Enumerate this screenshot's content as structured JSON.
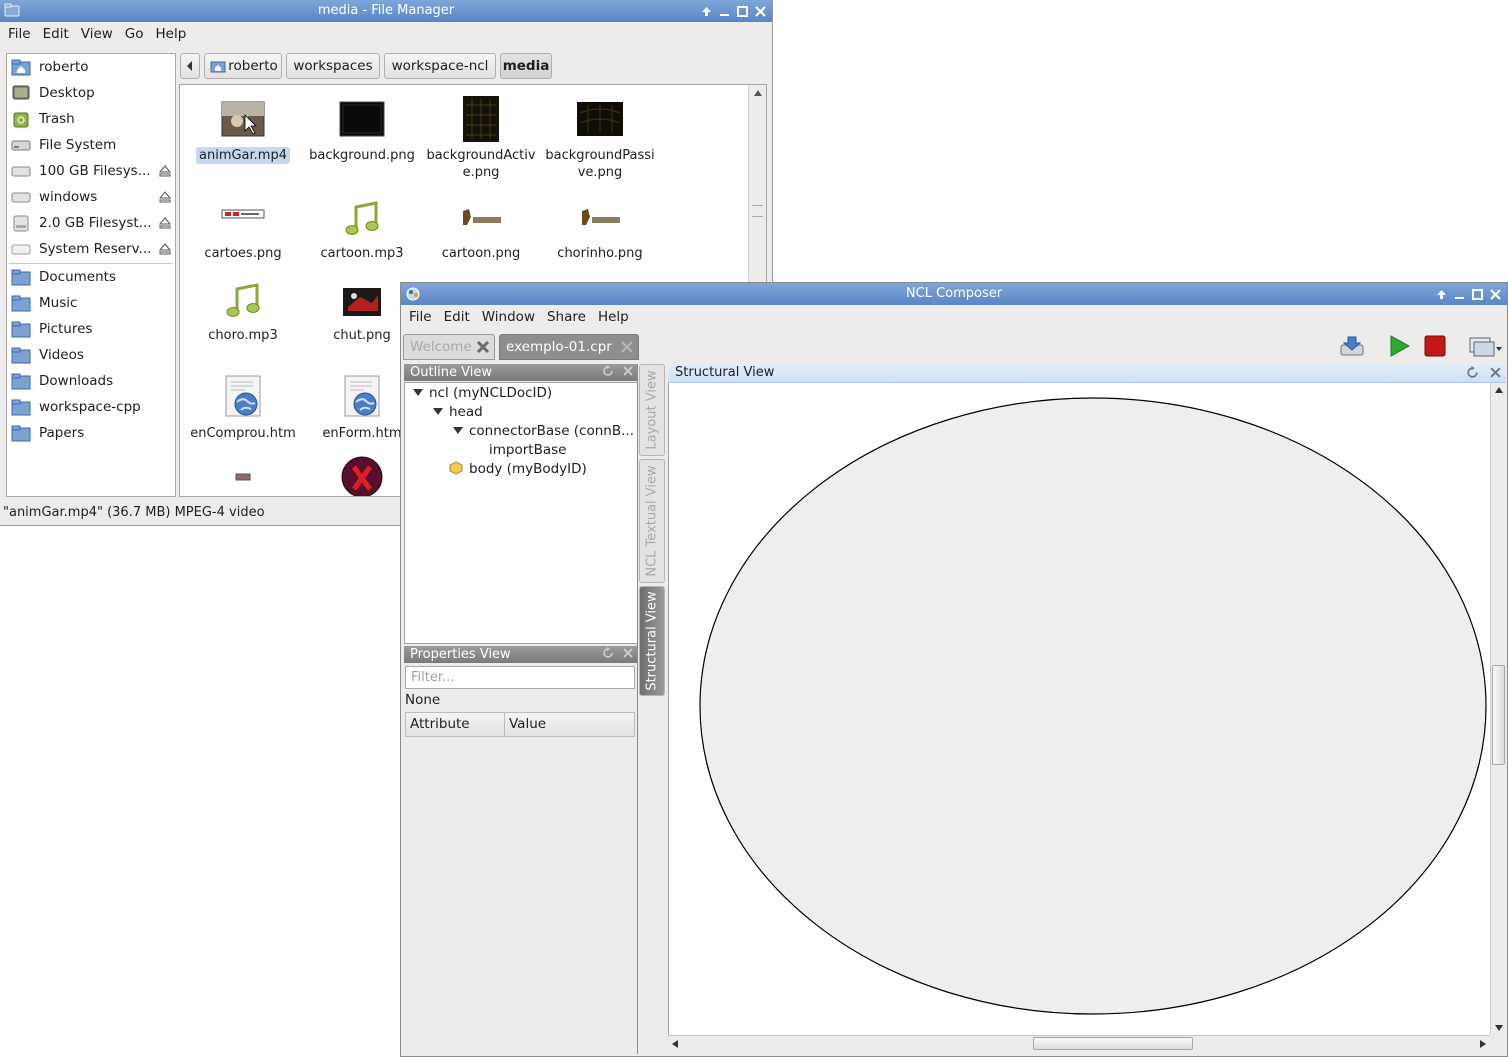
{
  "file_manager": {
    "title": "media - File Manager",
    "menu": [
      "File",
      "Edit",
      "View",
      "Go",
      "Help"
    ],
    "sidebar": [
      {
        "label": "roberto",
        "icon": "home-folder-icon"
      },
      {
        "label": "Desktop",
        "icon": "desktop-icon"
      },
      {
        "label": "Trash",
        "icon": "trash-icon"
      },
      {
        "label": "File System",
        "icon": "drive-icon"
      },
      {
        "label": "100 GB Filesys...",
        "icon": "drive-icon",
        "eject": true
      },
      {
        "label": "windows",
        "icon": "drive-icon",
        "eject": true
      },
      {
        "label": "2.0 GB Filesyst...",
        "icon": "drive-icon",
        "eject": true
      },
      {
        "label": "System Reserv...",
        "icon": "drive-icon",
        "eject": true
      },
      {
        "label": "Documents",
        "icon": "folder-icon"
      },
      {
        "label": "Music",
        "icon": "folder-icon"
      },
      {
        "label": "Pictures",
        "icon": "folder-icon"
      },
      {
        "label": "Videos",
        "icon": "folder-icon"
      },
      {
        "label": "Downloads",
        "icon": "folder-icon"
      },
      {
        "label": "workspace-cpp",
        "icon": "folder-icon"
      },
      {
        "label": "Papers",
        "icon": "folder-icon"
      }
    ],
    "path": [
      "roberto",
      "workspaces",
      "workspace-ncl",
      "media"
    ],
    "files": [
      {
        "name": "animGar.mp4",
        "selected": true
      },
      {
        "name": "background.png"
      },
      {
        "name": "backgroundActiv\ne.png"
      },
      {
        "name": "backgroundPassi\nve.png"
      },
      {
        "name": "cartoes.png"
      },
      {
        "name": "cartoon.mp3"
      },
      {
        "name": "cartoon.png"
      },
      {
        "name": "chorinho.png"
      },
      {
        "name": "choro.mp3"
      },
      {
        "name": "chut.png"
      },
      {
        "name": "enComprou.htm"
      },
      {
        "name": "enForm.htm"
      }
    ],
    "status": "\"animGar.mp4\" (36.7 MB) MPEG-4 video"
  },
  "ncl_composer": {
    "title": "NCL Composer",
    "menu": [
      "File",
      "Edit",
      "Window",
      "Share",
      "Help"
    ],
    "tabs": [
      {
        "label": "Welcome",
        "active": false
      },
      {
        "label": "exemplo-01.cpr",
        "active": true
      }
    ],
    "toolbar": [
      "import-icon",
      "play-icon",
      "stop-icon",
      "perspective-icon"
    ],
    "outline": {
      "title": "Outline View",
      "tree": [
        {
          "label": "ncl (myNCLDocID)",
          "level": 0,
          "expanded": true
        },
        {
          "label": "head",
          "level": 1,
          "expanded": true
        },
        {
          "label": "connectorBase (connB...",
          "level": 2,
          "expanded": true
        },
        {
          "label": "importBase",
          "level": 3
        },
        {
          "label": "body (myBodyID)",
          "level": 1,
          "icon": "body-icon"
        }
      ]
    },
    "properties": {
      "title": "Properties View",
      "filter_placeholder": "Filter...",
      "selection": "None",
      "columns": [
        "Attribute",
        "Value"
      ]
    },
    "side_tabs": [
      "Layout View",
      "NCL Textual View",
      "Structural View"
    ],
    "structural_view": {
      "title": "Structural View"
    },
    "colors": {
      "titlebar": "#6a93cd",
      "body_fill": "#eeeeee",
      "play": "#2fa82f",
      "stop": "#c21818"
    }
  }
}
